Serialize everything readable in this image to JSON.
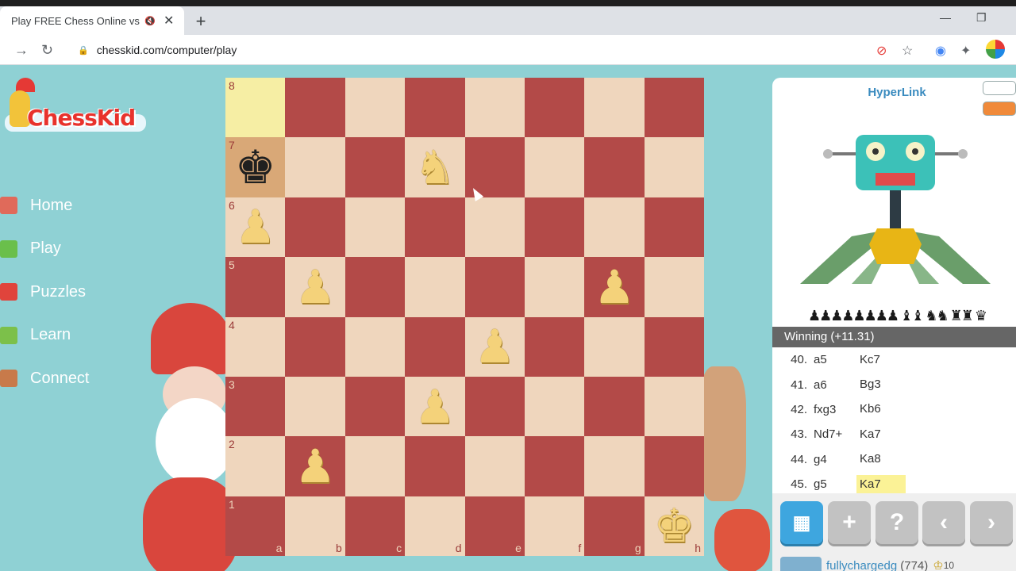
{
  "browser": {
    "tab_title": "Play FREE Chess Online vs th",
    "tab_close": "✕",
    "new_tab": "+",
    "url": "chesskid.com/computer/play",
    "minimize": "—",
    "restore": "❐"
  },
  "site": {
    "logo_text": "ChessKid",
    "nav": [
      {
        "label": "Home",
        "color": "#e06a5a"
      },
      {
        "label": "Play",
        "color": "#6abf4b"
      },
      {
        "label": "Puzzles",
        "color": "#e0443c"
      },
      {
        "label": "Learn",
        "color": "#7cc04a"
      },
      {
        "label": "Connect",
        "color": "#c87a4a"
      }
    ]
  },
  "board": {
    "files": [
      "a",
      "b",
      "c",
      "d",
      "e",
      "f",
      "g",
      "h"
    ],
    "ranks": [
      "8",
      "7",
      "6",
      "5",
      "4",
      "3",
      "2",
      "1"
    ],
    "pieces": {
      "a7": {
        "glyph": "♚",
        "color": "black"
      },
      "d7": {
        "glyph": "♞",
        "color": "white"
      },
      "a6": {
        "glyph": "♟",
        "color": "white"
      },
      "b5": {
        "glyph": "♟",
        "color": "white"
      },
      "g5": {
        "glyph": "♟",
        "color": "white"
      },
      "e4": {
        "glyph": "♟",
        "color": "white"
      },
      "d3": {
        "glyph": "♟",
        "color": "white"
      },
      "b2": {
        "glyph": "♟",
        "color": "white"
      },
      "h1": {
        "glyph": "♚",
        "color": "white"
      }
    },
    "highlight": [
      "a8",
      "a7"
    ]
  },
  "panel": {
    "bot_name": "HyperLink",
    "captured": "♟♟♟♟♟♟♟♟ ♝♝ ♞♞ ♜♜ ♛",
    "eval": "Winning (+11.31)",
    "moves": [
      {
        "num": "40.",
        "white": "a5",
        "black": "Kc7"
      },
      {
        "num": "41.",
        "white": "a6",
        "black": "Bg3"
      },
      {
        "num": "42.",
        "white": "fxg3",
        "black": "Kb6"
      },
      {
        "num": "43.",
        "white": "Nd7+",
        "black": "Ka7"
      },
      {
        "num": "44.",
        "white": "g4",
        "black": "Ka8"
      },
      {
        "num": "45.",
        "white": "g5",
        "black": "Ka7"
      }
    ],
    "active_move_index": 5,
    "controls": {
      "new_game": "+",
      "hint": "?",
      "back": "‹",
      "forward": "›"
    },
    "user": {
      "name": "fullychargedg",
      "rating": "(774)",
      "badge": "10"
    }
  },
  "colors": {
    "light_square": "#efd6bd",
    "dark_square": "#b34a48",
    "accent": "#3ea6df"
  }
}
